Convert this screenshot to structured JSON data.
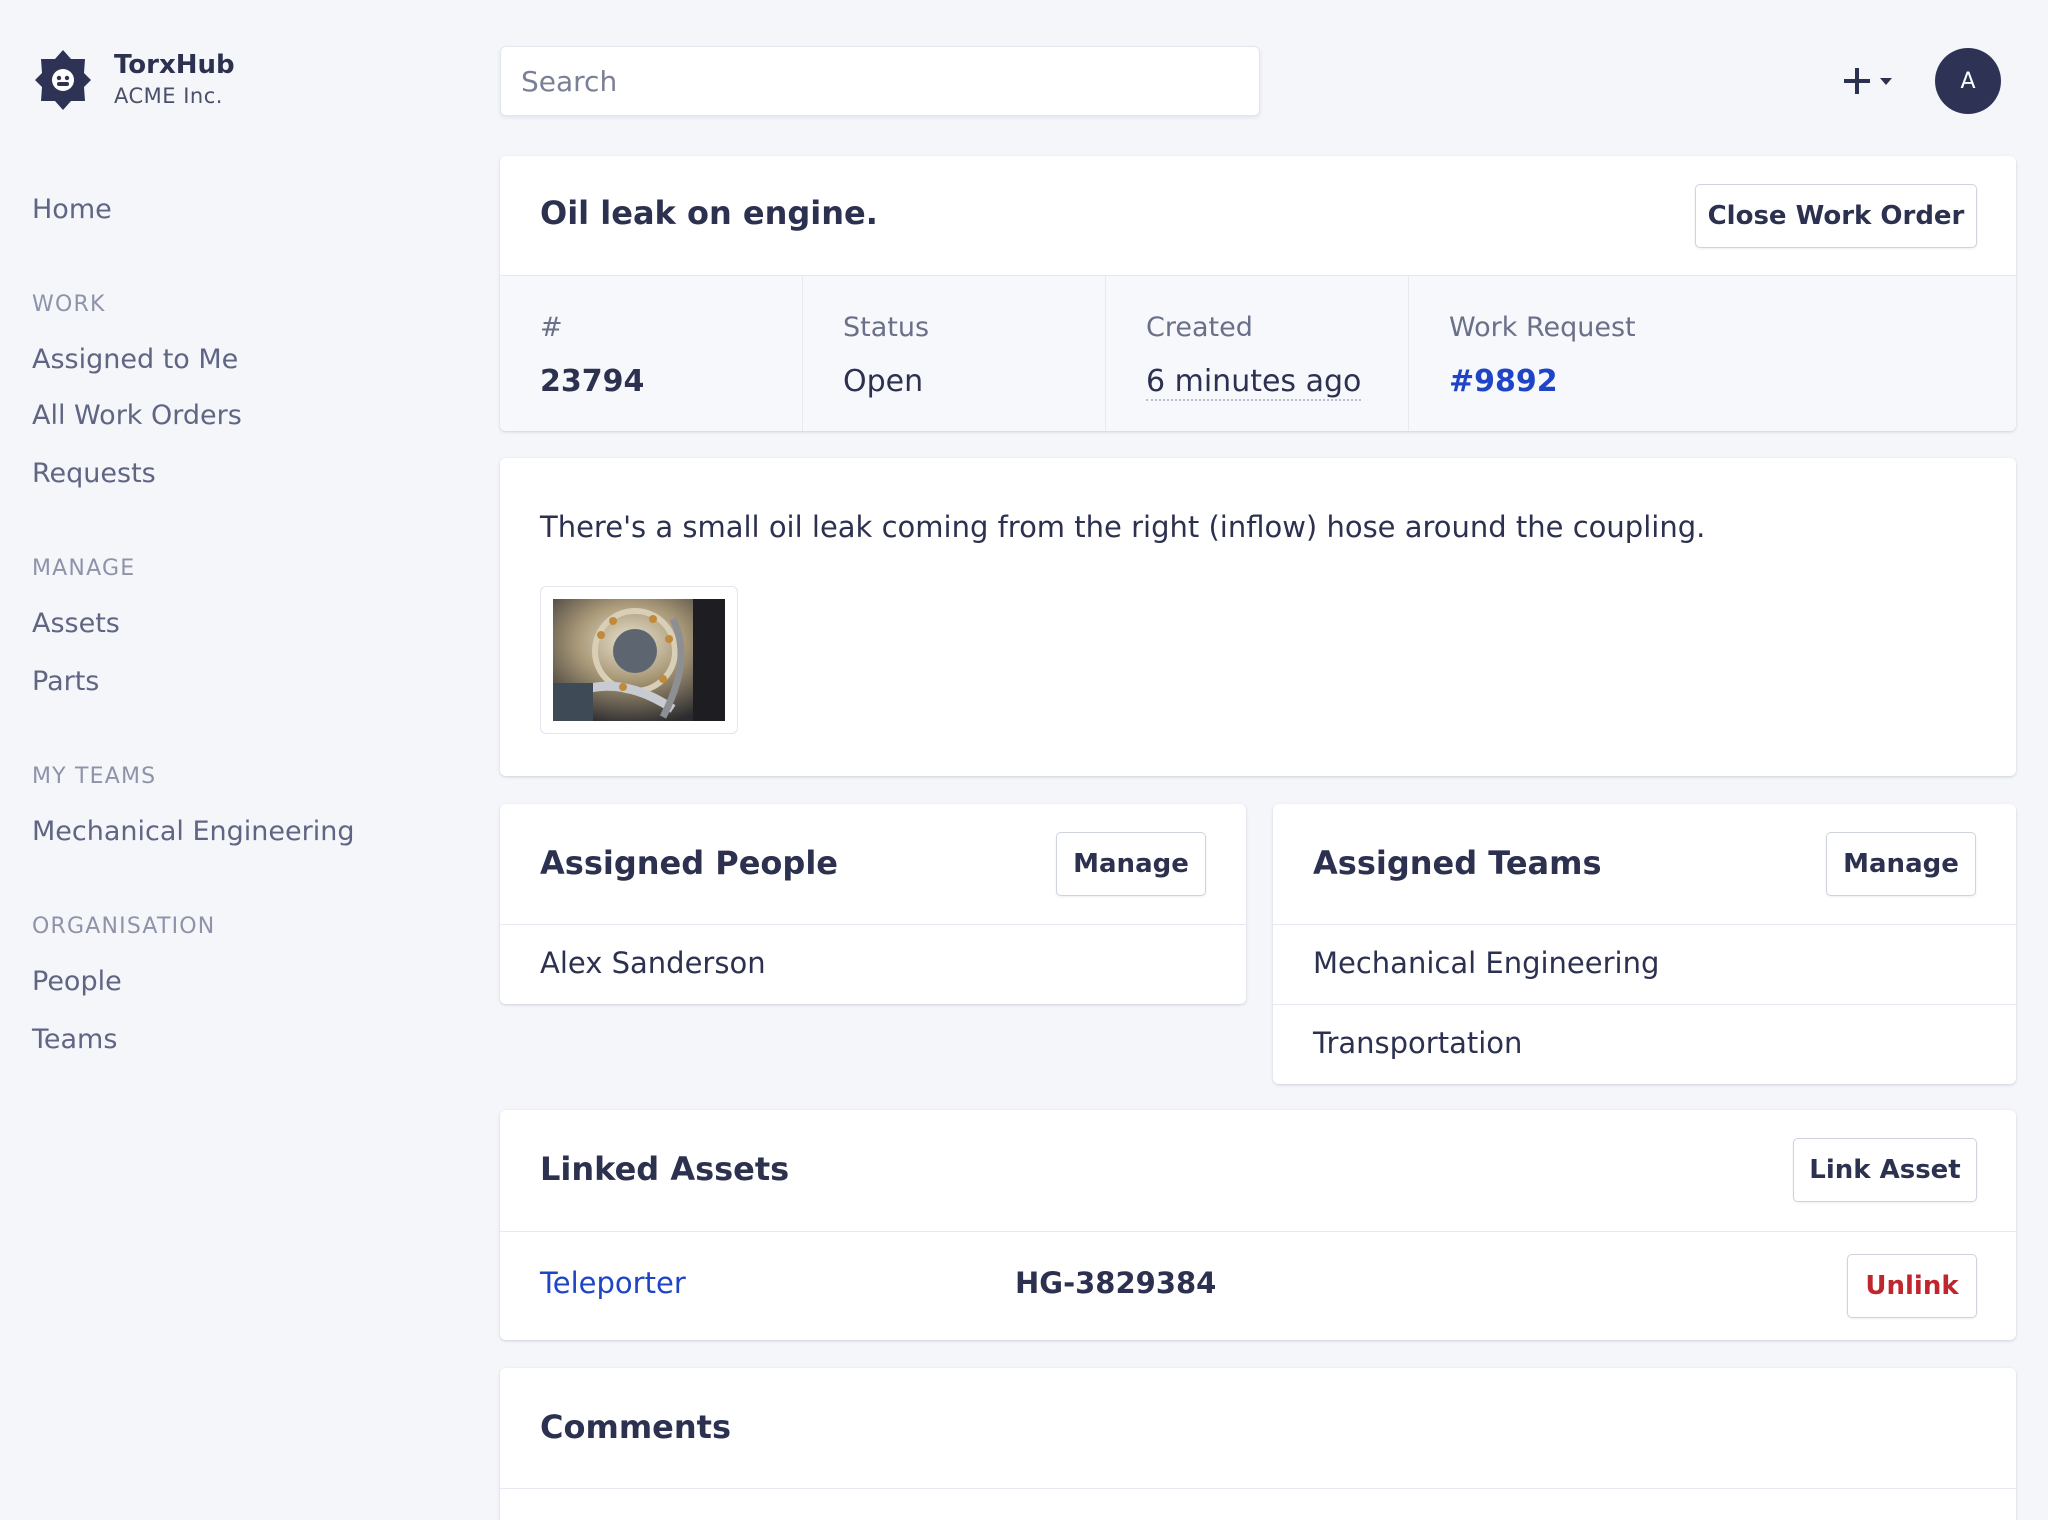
{
  "brand": {
    "name": "TorxHub",
    "org": "ACME Inc."
  },
  "nav": {
    "home": "Home",
    "sections": [
      {
        "title": "WORK",
        "items": [
          "Assigned to Me",
          "All Work Orders",
          "Requests"
        ]
      },
      {
        "title": "MANAGE",
        "items": [
          "Assets",
          "Parts"
        ]
      },
      {
        "title": "MY TEAMS",
        "items": [
          "Mechanical Engineering"
        ]
      },
      {
        "title": "ORGANISATION",
        "items": [
          "People",
          "Teams"
        ]
      }
    ]
  },
  "topbar": {
    "search_placeholder": "Search",
    "avatar_initial": "A"
  },
  "work_order": {
    "title": "Oil leak on engine.",
    "close_label": "Close Work Order",
    "stats": [
      {
        "label": "#",
        "value": "23794"
      },
      {
        "label": "Status",
        "value": "Open"
      },
      {
        "label": "Created",
        "value": "6 minutes ago"
      },
      {
        "label": "Work Request",
        "value": "#9892"
      }
    ],
    "description": "There's a small oil leak coming from the right (inflow) hose around the coupling."
  },
  "assigned_people": {
    "title": "Assigned People",
    "manage_label": "Manage",
    "people": [
      "Alex Sanderson"
    ]
  },
  "assigned_teams": {
    "title": "Assigned Teams",
    "manage_label": "Manage",
    "teams": [
      "Mechanical Engineering",
      "Transportation"
    ]
  },
  "linked_assets": {
    "title": "Linked Assets",
    "link_label": "Link Asset",
    "assets": [
      {
        "name": "Teleporter",
        "code": "HG-3829384",
        "unlink_label": "Unlink"
      }
    ]
  },
  "comments": {
    "title": "Comments"
  },
  "colors": {
    "primary_dark": "#2e3356",
    "link": "#1f45c6",
    "danger": "#c0262d",
    "background": "#f4f6fa"
  },
  "icons": {
    "add": "plus-icon",
    "dropdown": "caret-down-icon",
    "logo": "gear-logo-icon"
  }
}
